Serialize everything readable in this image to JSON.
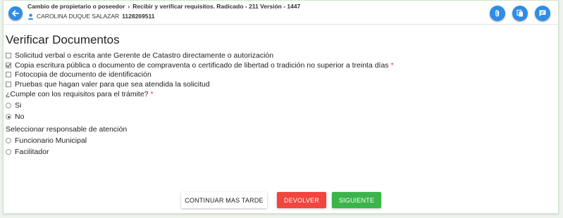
{
  "header": {
    "breadcrumb_process": "Cambio de propietario o poseedor",
    "breadcrumb_step": "Recibir y verificar requisitos. Radicado - 211 Versión - 1447",
    "user_name": "CAROLINA DUQUE SALAZAR",
    "user_id": "1128269511",
    "icons": [
      "back-arrow-icon",
      "person-icon",
      "attachment-icon",
      "documents-icon",
      "comment-icon"
    ]
  },
  "main": {
    "title": "Verificar Documentos",
    "documents": [
      {
        "label": "Solicitud verbal o escrita ante Gerente de Catastro directamente o autorización",
        "checked": false,
        "required": false
      },
      {
        "label": "Copia escritura pública o documento de compraventa o certificado de libertad o tradición no superior a treinta días",
        "checked": true,
        "required": true
      },
      {
        "label": "Fotocopia de documento de identificación",
        "checked": false,
        "required": false
      },
      {
        "label": "Pruebas que hagan valer para que sea atendida la solicitud",
        "checked": false,
        "required": false
      }
    ],
    "requirements_question": "¿Cumple con los requisitos para el trámite?",
    "requirements_required_mark": "*",
    "requirements_options": [
      {
        "label": "Si",
        "selected": false
      },
      {
        "label": "No",
        "selected": true
      }
    ],
    "responsible_label": "Seleccionar responsable de atención",
    "responsible_options": [
      {
        "label": "Funcionario Municipal",
        "selected": false
      },
      {
        "label": "Facilitador",
        "selected": false
      }
    ],
    "required_mark": "*"
  },
  "actions": {
    "continue_later": "CONTINUAR MAS TARDE",
    "return": "DEVOLVER",
    "next": "SIGUIENTE"
  },
  "colors": {
    "primary_blue": "#2f8de4",
    "danger_red": "#f1453d",
    "success_green": "#3bb54a",
    "required_red": "#e53935"
  }
}
